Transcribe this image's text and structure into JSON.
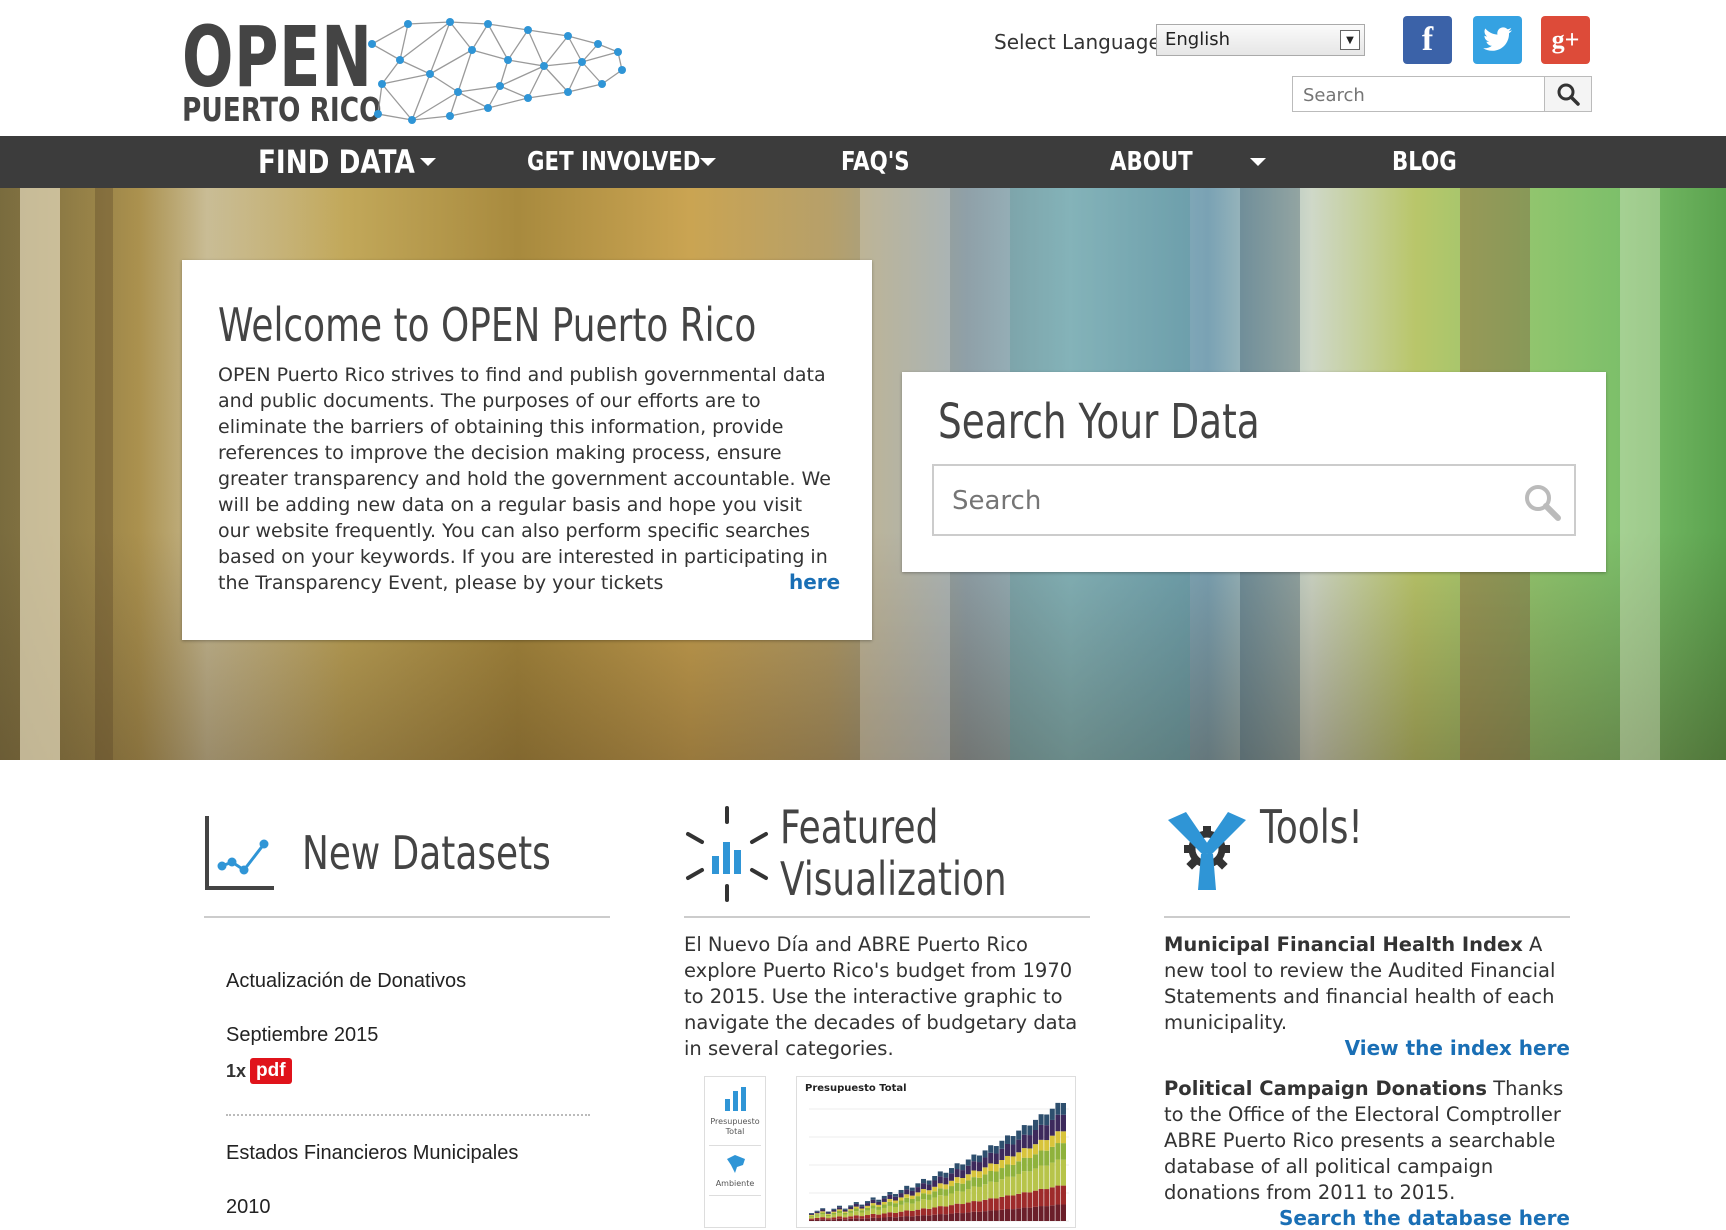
{
  "logo": {
    "line1": "OPEN",
    "line2": "PUERTO RICO"
  },
  "header": {
    "language_label": "Select Language",
    "language_value": "English",
    "social": {
      "facebook": "f",
      "twitter": "twitter-icon",
      "google": "g+"
    },
    "search_placeholder": "Search"
  },
  "nav": {
    "items": [
      {
        "label": "FIND DATA",
        "has_dropdown": true
      },
      {
        "label": "GET INVOLVED",
        "has_dropdown": true
      },
      {
        "label": "FAQ'S",
        "has_dropdown": false
      },
      {
        "label": "ABOUT",
        "has_dropdown": true
      },
      {
        "label": "BLOG",
        "has_dropdown": false
      }
    ]
  },
  "hero": {
    "welcome_title": "Welcome to OPEN Puerto Rico",
    "welcome_body": "OPEN Puerto Rico strives to find and publish governmental data and public documents. The purposes of our efforts are to eliminate the barriers of obtaining this information, provide references to improve the decision making process, ensure greater transparency and hold the government accountable. We will be adding new data on a regular basis and hope you visit our website frequently. You can also perform specific searches based on your keywords. If you are interested in participating in the Transparency Event, please by your tickets",
    "welcome_link": "here",
    "search_title": "Search Your Data",
    "search_placeholder": "Search"
  },
  "new_datasets": {
    "title": "New Datasets",
    "items": [
      {
        "name": "Actualización de Donativos",
        "period": "Septiembre 2015",
        "count": "1x",
        "format": "pdf"
      },
      {
        "name": "Estados Financieros Municipales",
        "period": "2010"
      }
    ]
  },
  "featured": {
    "title_line1": "Featured",
    "title_line2": "Visualization",
    "body": "El Nuevo Día and ABRE Puerto Rico explore Puerto Rico's budget from 1970 to 2015. Use the interactive graphic to navigate the decades of budgetary data in several categories.",
    "thumb_chart_title": "Presupuesto Total",
    "thumb_tab1": "Presupuesto Total",
    "thumb_tab2": "Ambiente"
  },
  "tools": {
    "title": "Tools!",
    "item1_bold": "Municipal Financial Health Index",
    "item1_text": " A new tool to review the Audited Financial Statements and financial health of each municipality.",
    "item1_link": "View the index here",
    "item2_bold": "Political Campaign Donations",
    "item2_text": " Thanks to the Office of the Electoral Comptroller ABRE Puerto Rico presents a searchable database of all political campaign donations from 2011 to 2015.",
    "item2_link": "Search the database here"
  },
  "colors": {
    "nav_bg": "#3c3c3c",
    "link": "#1a6fb5",
    "accent_blue": "#35a2e2",
    "pdf_red": "#e0131b"
  }
}
